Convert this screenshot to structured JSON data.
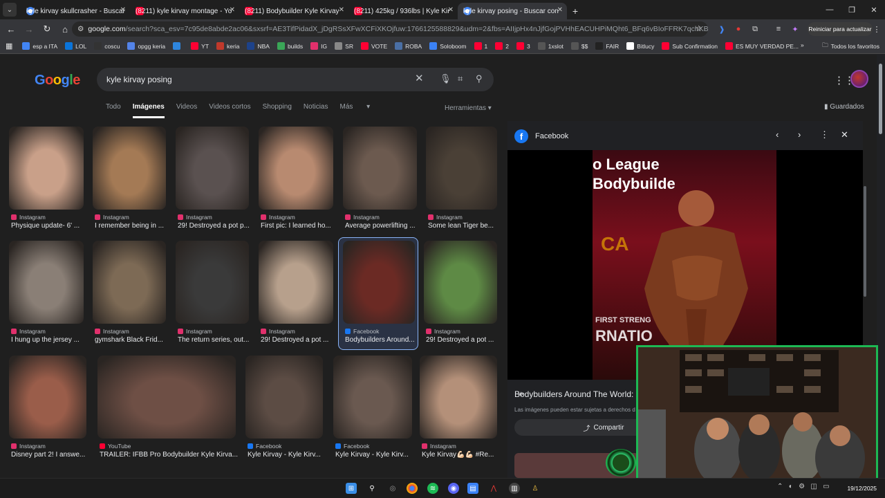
{
  "browser": {
    "tabs": [
      {
        "title": "kyle kirvay skullcrasher - Buscar",
        "favicon": "google-icon",
        "active": false
      },
      {
        "title": "(8211) kyle kirvay montage - Yo",
        "favicon": "youtube-icon",
        "active": false
      },
      {
        "title": "(8211) Bodybuilder Kyle Kirvay",
        "favicon": "youtube-icon",
        "active": false
      },
      {
        "title": "(8211) 425kg / 936lbs | Kyle Kir",
        "favicon": "youtube-icon",
        "active": false
      },
      {
        "title": "kyle kirvay posing - Buscar con",
        "favicon": "google-icon",
        "active": true
      }
    ],
    "url_host": "google.com",
    "url_rest": "/search?sca_esv=7c95de8abde2ac06&sxsrf=AE3TifPidadX_jDgRSsXFwXCFiXKOjfuw:1766125588829&udm=2&fbs=AIIjpHx4nJjfGojPVHhEACUHPiMQht6_BFq6vBIoFFRK7qchKBv8IM7dq8CEqHDU3B...",
    "restart_label": "Reiniciar para actualizar",
    "bookmarks": [
      {
        "label": "esp a ITA",
        "color": "#4285f4"
      },
      {
        "label": "LOL",
        "color": "#0a74da"
      },
      {
        "label": "coscu",
        "color": "#333333"
      },
      {
        "label": "opgg keria",
        "color": "#5383e8"
      },
      {
        "label": "",
        "color": "#2e86de"
      },
      {
        "label": "YT",
        "color": "#ff0033"
      },
      {
        "label": "keria",
        "color": "#c0392b"
      },
      {
        "label": "NBA",
        "color": "#1d428a"
      },
      {
        "label": "builds",
        "color": "#3aa657"
      },
      {
        "label": "IG",
        "color": "#e1306c"
      },
      {
        "label": "SR",
        "color": "#888888"
      },
      {
        "label": "VOTE",
        "color": "#ff0033"
      },
      {
        "label": "ROBA",
        "color": "#4a6fa5"
      },
      {
        "label": "Soloboom",
        "color": "#3b82f6"
      },
      {
        "label": "1",
        "color": "#ff0033"
      },
      {
        "label": "2",
        "color": "#ff0033"
      },
      {
        "label": "3",
        "color": "#ff0033"
      },
      {
        "label": "1xslot",
        "color": "#555555"
      },
      {
        "label": "$$",
        "color": "#555555"
      },
      {
        "label": "FAIR",
        "color": "#222222"
      },
      {
        "label": "Bitlucy",
        "color": "#ffffff"
      },
      {
        "label": "Sub Confirmation",
        "color": "#ff0033"
      },
      {
        "label": "ES MUY VERDAD PE...",
        "color": "#ff0033"
      }
    ],
    "all_favorites": "Todos los favoritos"
  },
  "google": {
    "logo_letters": [
      "G",
      "o",
      "o",
      "g",
      "l",
      "e"
    ],
    "query": "kyle kirvay posing",
    "tabs": [
      "Todo",
      "Imágenes",
      "Videos",
      "Videos cortos",
      "Shopping",
      "Noticias",
      "Más"
    ],
    "selected_tab": "Imágenes",
    "tools_label": "Herramientas",
    "saved_label": "Guardados"
  },
  "results": [
    {
      "source": "Instagram",
      "title": "Physique update- 6' ...",
      "color": "#c9a089"
    },
    {
      "source": "Instagram",
      "title": "I remember being in ...",
      "color": "#a47a55"
    },
    {
      "source": "Instagram",
      "title": "29! Destroyed a pot p...",
      "color": "#5a5150"
    },
    {
      "source": "Instagram",
      "title": "First pic: I learned ho...",
      "color": "#b88a70"
    },
    {
      "source": "Instagram",
      "title": "Average powerlifting ...",
      "color": "#6c5a4f"
    },
    {
      "source": "Instagram",
      "title": "Some lean Tiger be...",
      "color": "#4a4036"
    },
    {
      "source": "Instagram",
      "title": "I hung up the jersey ...",
      "color": "#8a7f76"
    },
    {
      "source": "Instagram",
      "title": "gymshark Black Frid...",
      "color": "#7d6a55"
    },
    {
      "source": "Instagram",
      "title": "The return series, out...",
      "color": "#3a3a3a"
    },
    {
      "source": "Instagram",
      "title": "29! Destroyed a pot ...",
      "color": "#b7a08c"
    },
    {
      "source": "Facebook",
      "title": "Bodybuilders Around...",
      "color": "#6b2a24"
    },
    {
      "source": "Instagram",
      "title": "29! Destroyed a pot ...",
      "color": "#5e8a45"
    },
    {
      "source": "Instagram",
      "title": "Disney part 2! I answe...",
      "color": "#9a5d4a"
    },
    {
      "source": "YouTube",
      "title": "TRAILER: IFBB Pro Bodybuilder Kyle Kirva...",
      "color": "#6e4f45"
    },
    {
      "source": "Facebook",
      "title": "Kyle Kirvay - Kyle Kirv...",
      "color": "#5c4c44"
    },
    {
      "source": "Facebook",
      "title": "Kyle Kirvay - Kyle Kirv...",
      "color": "#6a5950"
    },
    {
      "source": "Instagram",
      "title": "Kyle Kirvay💪🏻💪🏻 #Re...",
      "color": "#b49079"
    }
  ],
  "panel": {
    "source": "Facebook",
    "image_text_1": "o League",
    "image_text_2": "Bodybuilde",
    "image_text_3": "FIRST STRENG",
    "image_text_4": "RNATIO",
    "title": "Bodybuilders Around The World:",
    "rights": "Las imágenes pueden estar sujetas a derechos d",
    "share_label": "Compartir"
  },
  "taskbar": {
    "date": "19/12/2025"
  },
  "colors": {
    "accent": "#8ab4f8",
    "webcam_border": "#1db954",
    "page_bg": "#1f1f1f"
  }
}
